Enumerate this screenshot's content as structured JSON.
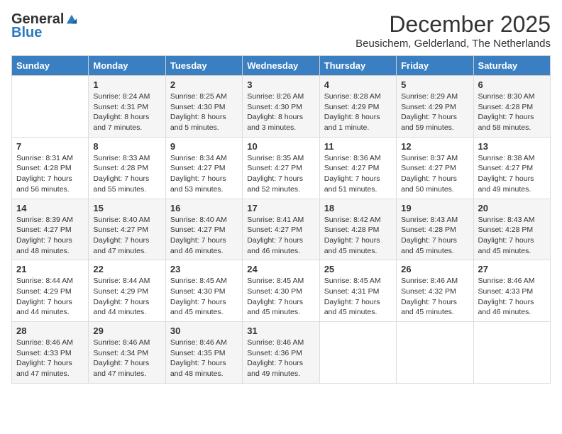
{
  "logo": {
    "general": "General",
    "blue": "Blue"
  },
  "header": {
    "month_year": "December 2025",
    "location": "Beusichem, Gelderland, The Netherlands"
  },
  "weekdays": [
    "Sunday",
    "Monday",
    "Tuesday",
    "Wednesday",
    "Thursday",
    "Friday",
    "Saturday"
  ],
  "weeks": [
    [
      {
        "day": "",
        "sunrise": "",
        "sunset": "",
        "daylight": ""
      },
      {
        "day": "1",
        "sunrise": "Sunrise: 8:24 AM",
        "sunset": "Sunset: 4:31 PM",
        "daylight": "Daylight: 8 hours and 7 minutes."
      },
      {
        "day": "2",
        "sunrise": "Sunrise: 8:25 AM",
        "sunset": "Sunset: 4:30 PM",
        "daylight": "Daylight: 8 hours and 5 minutes."
      },
      {
        "day": "3",
        "sunrise": "Sunrise: 8:26 AM",
        "sunset": "Sunset: 4:30 PM",
        "daylight": "Daylight: 8 hours and 3 minutes."
      },
      {
        "day": "4",
        "sunrise": "Sunrise: 8:28 AM",
        "sunset": "Sunset: 4:29 PM",
        "daylight": "Daylight: 8 hours and 1 minute."
      },
      {
        "day": "5",
        "sunrise": "Sunrise: 8:29 AM",
        "sunset": "Sunset: 4:29 PM",
        "daylight": "Daylight: 7 hours and 59 minutes."
      },
      {
        "day": "6",
        "sunrise": "Sunrise: 8:30 AM",
        "sunset": "Sunset: 4:28 PM",
        "daylight": "Daylight: 7 hours and 58 minutes."
      }
    ],
    [
      {
        "day": "7",
        "sunrise": "Sunrise: 8:31 AM",
        "sunset": "Sunset: 4:28 PM",
        "daylight": "Daylight: 7 hours and 56 minutes."
      },
      {
        "day": "8",
        "sunrise": "Sunrise: 8:33 AM",
        "sunset": "Sunset: 4:28 PM",
        "daylight": "Daylight: 7 hours and 55 minutes."
      },
      {
        "day": "9",
        "sunrise": "Sunrise: 8:34 AM",
        "sunset": "Sunset: 4:27 PM",
        "daylight": "Daylight: 7 hours and 53 minutes."
      },
      {
        "day": "10",
        "sunrise": "Sunrise: 8:35 AM",
        "sunset": "Sunset: 4:27 PM",
        "daylight": "Daylight: 7 hours and 52 minutes."
      },
      {
        "day": "11",
        "sunrise": "Sunrise: 8:36 AM",
        "sunset": "Sunset: 4:27 PM",
        "daylight": "Daylight: 7 hours and 51 minutes."
      },
      {
        "day": "12",
        "sunrise": "Sunrise: 8:37 AM",
        "sunset": "Sunset: 4:27 PM",
        "daylight": "Daylight: 7 hours and 50 minutes."
      },
      {
        "day": "13",
        "sunrise": "Sunrise: 8:38 AM",
        "sunset": "Sunset: 4:27 PM",
        "daylight": "Daylight: 7 hours and 49 minutes."
      }
    ],
    [
      {
        "day": "14",
        "sunrise": "Sunrise: 8:39 AM",
        "sunset": "Sunset: 4:27 PM",
        "daylight": "Daylight: 7 hours and 48 minutes."
      },
      {
        "day": "15",
        "sunrise": "Sunrise: 8:40 AM",
        "sunset": "Sunset: 4:27 PM",
        "daylight": "Daylight: 7 hours and 47 minutes."
      },
      {
        "day": "16",
        "sunrise": "Sunrise: 8:40 AM",
        "sunset": "Sunset: 4:27 PM",
        "daylight": "Daylight: 7 hours and 46 minutes."
      },
      {
        "day": "17",
        "sunrise": "Sunrise: 8:41 AM",
        "sunset": "Sunset: 4:27 PM",
        "daylight": "Daylight: 7 hours and 46 minutes."
      },
      {
        "day": "18",
        "sunrise": "Sunrise: 8:42 AM",
        "sunset": "Sunset: 4:28 PM",
        "daylight": "Daylight: 7 hours and 45 minutes."
      },
      {
        "day": "19",
        "sunrise": "Sunrise: 8:43 AM",
        "sunset": "Sunset: 4:28 PM",
        "daylight": "Daylight: 7 hours and 45 minutes."
      },
      {
        "day": "20",
        "sunrise": "Sunrise: 8:43 AM",
        "sunset": "Sunset: 4:28 PM",
        "daylight": "Daylight: 7 hours and 45 minutes."
      }
    ],
    [
      {
        "day": "21",
        "sunrise": "Sunrise: 8:44 AM",
        "sunset": "Sunset: 4:29 PM",
        "daylight": "Daylight: 7 hours and 44 minutes."
      },
      {
        "day": "22",
        "sunrise": "Sunrise: 8:44 AM",
        "sunset": "Sunset: 4:29 PM",
        "daylight": "Daylight: 7 hours and 44 minutes."
      },
      {
        "day": "23",
        "sunrise": "Sunrise: 8:45 AM",
        "sunset": "Sunset: 4:30 PM",
        "daylight": "Daylight: 7 hours and 45 minutes."
      },
      {
        "day": "24",
        "sunrise": "Sunrise: 8:45 AM",
        "sunset": "Sunset: 4:30 PM",
        "daylight": "Daylight: 7 hours and 45 minutes."
      },
      {
        "day": "25",
        "sunrise": "Sunrise: 8:45 AM",
        "sunset": "Sunset: 4:31 PM",
        "daylight": "Daylight: 7 hours and 45 minutes."
      },
      {
        "day": "26",
        "sunrise": "Sunrise: 8:46 AM",
        "sunset": "Sunset: 4:32 PM",
        "daylight": "Daylight: 7 hours and 45 minutes."
      },
      {
        "day": "27",
        "sunrise": "Sunrise: 8:46 AM",
        "sunset": "Sunset: 4:33 PM",
        "daylight": "Daylight: 7 hours and 46 minutes."
      }
    ],
    [
      {
        "day": "28",
        "sunrise": "Sunrise: 8:46 AM",
        "sunset": "Sunset: 4:33 PM",
        "daylight": "Daylight: 7 hours and 47 minutes."
      },
      {
        "day": "29",
        "sunrise": "Sunrise: 8:46 AM",
        "sunset": "Sunset: 4:34 PM",
        "daylight": "Daylight: 7 hours and 47 minutes."
      },
      {
        "day": "30",
        "sunrise": "Sunrise: 8:46 AM",
        "sunset": "Sunset: 4:35 PM",
        "daylight": "Daylight: 7 hours and 48 minutes."
      },
      {
        "day": "31",
        "sunrise": "Sunrise: 8:46 AM",
        "sunset": "Sunset: 4:36 PM",
        "daylight": "Daylight: 7 hours and 49 minutes."
      },
      {
        "day": "",
        "sunrise": "",
        "sunset": "",
        "daylight": ""
      },
      {
        "day": "",
        "sunrise": "",
        "sunset": "",
        "daylight": ""
      },
      {
        "day": "",
        "sunrise": "",
        "sunset": "",
        "daylight": ""
      }
    ]
  ]
}
